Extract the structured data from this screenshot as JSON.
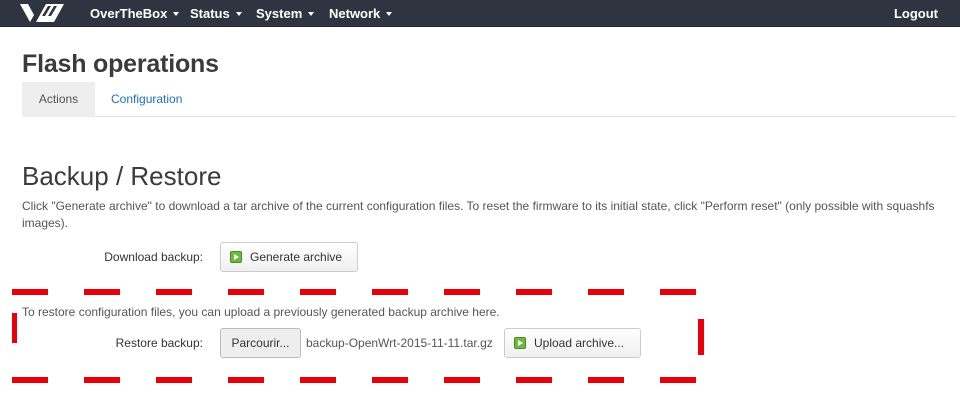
{
  "navbar": {
    "menus": [
      {
        "label": "OverTheBox"
      },
      {
        "label": "Status"
      },
      {
        "label": "System"
      },
      {
        "label": "Network"
      }
    ],
    "logout_label": "Logout"
  },
  "page": {
    "title": "Flash operations",
    "tabs": [
      {
        "label": "Actions",
        "active": true
      },
      {
        "label": "Configuration",
        "active": false
      }
    ]
  },
  "section": {
    "title": "Backup / Restore",
    "description": "Click \"Generate archive\" to download a tar archive of the current configuration files. To reset the firmware to its initial state, click \"Perform reset\" (only possible with squashfs images).",
    "download_label": "Download backup:",
    "generate_button": "Generate archive",
    "restore_text": "To restore configuration files, you can upload a previously generated backup archive here.",
    "restore_label": "Restore backup:",
    "browse_button": "Parcourir...",
    "selected_file": "backup-OpenWrt-2015-11-11.tar.gz",
    "upload_button": "Upload archive..."
  },
  "colors": {
    "navbar": "#2f3540",
    "link": "#1f6fbf",
    "annotation": "#e8000b",
    "button_icon": "#6dbb3a"
  },
  "icons": {
    "logo": "ovh-logo",
    "caret": "chevron-down-icon",
    "button_icon": "play-icon"
  }
}
